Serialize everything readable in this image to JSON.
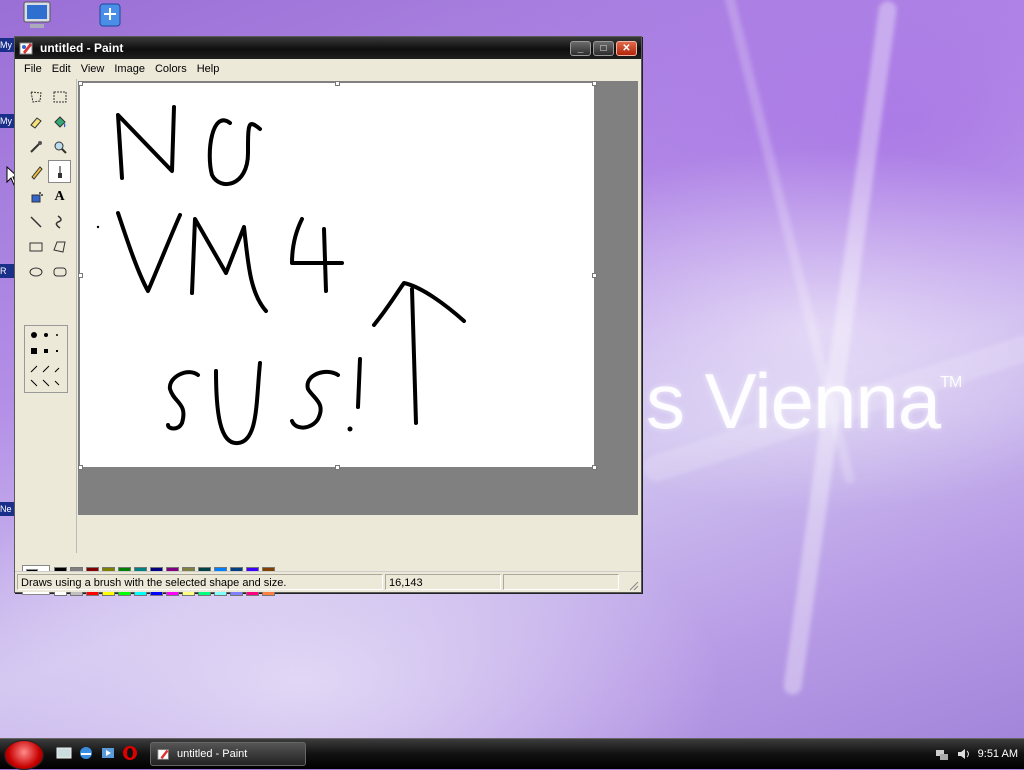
{
  "desktop": {
    "brand": "s Vienna",
    "brand_tm": "TM",
    "icon_stubs": [
      "My",
      "My",
      "R",
      "Ne"
    ]
  },
  "window": {
    "title": "untitled - Paint",
    "controls": {
      "minimize": "_",
      "maximize": "□",
      "close": "✕"
    },
    "menu": [
      "File",
      "Edit",
      "View",
      "Image",
      "Colors",
      "Help"
    ],
    "tools": [
      "free-form-select-icon",
      "rectangle-select-icon",
      "eraser-icon",
      "fill-bucket-icon",
      "color-picker-icon",
      "magnifier-icon",
      "pencil-icon",
      "brush-icon",
      "airbrush-icon",
      "text-icon",
      "line-icon",
      "curve-icon",
      "rectangle-icon",
      "polygon-icon",
      "ellipse-icon",
      "rounded-rectangle-icon"
    ],
    "selected_tool": "brush-icon",
    "text_tool_glyph": "A",
    "palette_top": [
      "#000000",
      "#808080",
      "#800000",
      "#808000",
      "#008000",
      "#008080",
      "#000080",
      "#800080",
      "#808040",
      "#004040",
      "#0080ff",
      "#004080",
      "#4000ff",
      "#804000"
    ],
    "palette_bottom": [
      "#ffffff",
      "#c0c0c0",
      "#ff0000",
      "#ffff00",
      "#00ff00",
      "#00ffff",
      "#0000ff",
      "#ff00ff",
      "#ffff80",
      "#00ff80",
      "#80ffff",
      "#8080ff",
      "#ff0080",
      "#ff8040"
    ],
    "foreground": "#000000",
    "background": "#ffffff",
    "status": {
      "hint": "Draws using a brush with the selected shape and size.",
      "coords": "16,143",
      "size": ""
    }
  },
  "taskbar": {
    "task_label": "untitled - Paint",
    "clock": "9:51 AM",
    "quicklaunch": [
      "show-desktop-icon",
      "internet-explorer-icon",
      "media-icon",
      "opera-icon"
    ]
  }
}
